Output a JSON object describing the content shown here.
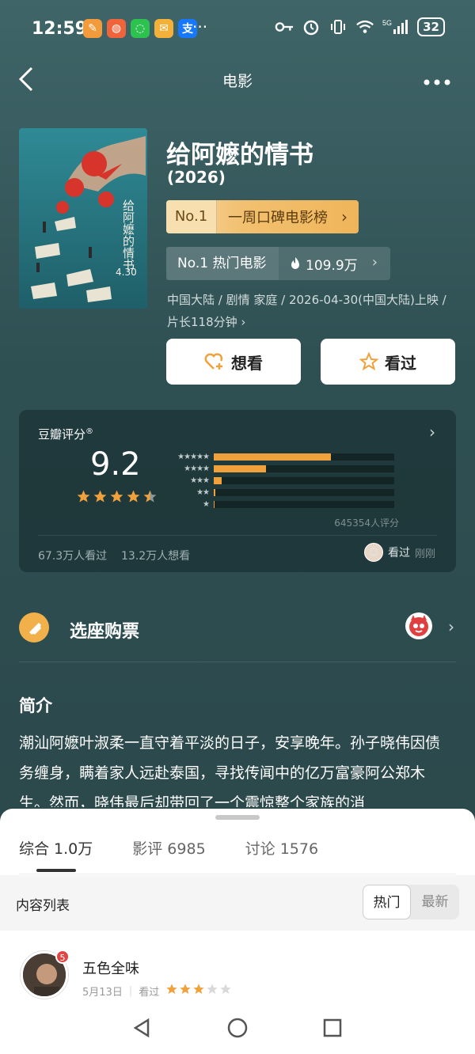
{
  "status_bar": {
    "time": "12:59",
    "more": "···",
    "network": "5G",
    "battery": "32"
  },
  "nav": {
    "title": "电影"
  },
  "movie": {
    "title": "给阿嬷的情书",
    "year": "(2026)",
    "poster_title": "给阿嬷的情书",
    "poster_date": "4.30",
    "rank1_no": "No.1",
    "rank1_label": "一周口碑电影榜",
    "rank2_label": "No.1 热门电影",
    "rank2_heat": "109.9万",
    "meta": "中国大陆 / 剧情 家庭 / 2026-04-30(中国大陆)上映 / 片长118分钟",
    "want_label": "想看",
    "seen_label": "看过"
  },
  "rating": {
    "label": "豆瓣评分",
    "registered": "®",
    "score": "9.2",
    "stars": 4.5,
    "distribution": [
      0.65,
      0.29,
      0.045,
      0.01,
      0.005
    ],
    "count": "645354人评分",
    "seen_count": "67.3万人看过",
    "want_count": "13.2万人想看",
    "my_status": "看过",
    "my_time": "刚刚"
  },
  "tickets": {
    "label": "选座购票"
  },
  "intro": {
    "title": "简介",
    "text": "潮汕阿嬷叶淑柔一直守着平淡的日子，安享晚年。孙子晓伟因债务缠身，瞒着家人远赴泰国，寻找传闻中的亿万富豪阿公郑木生。然而，晓伟最后却带回了一个震惊整个家族的消"
  },
  "sheet": {
    "tabs": [
      "综合 1.0万",
      "影评 6985",
      "讨论 1576"
    ],
    "list_label": "内容列表",
    "sort_hot": "热门",
    "sort_new": "最新",
    "review": {
      "name": "五色全味",
      "badge": "5",
      "date": "5月13日",
      "status": "看过",
      "stars": 3
    }
  },
  "colors": {
    "bg": "#2f5053",
    "accent": "#f0a13c",
    "rank_gold": "#f2c070"
  }
}
